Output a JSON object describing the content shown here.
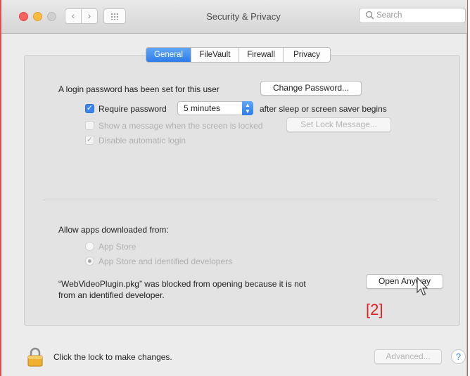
{
  "window": {
    "title": "Security & Privacy",
    "search_placeholder": "Search"
  },
  "tabs": [
    {
      "label": "General",
      "active": true
    },
    {
      "label": "FileVault",
      "active": false
    },
    {
      "label": "Firewall",
      "active": false
    },
    {
      "label": "Privacy",
      "active": false
    }
  ],
  "general": {
    "login_password_text": "A login password has been set for this user",
    "change_password_label": "Change Password...",
    "require_password": {
      "checked": true,
      "label": "Require password",
      "interval": "5 minutes",
      "suffix": "after sleep or screen saver begins"
    },
    "show_message": {
      "checked": false,
      "label": "Show a message when the screen is locked",
      "button": "Set Lock Message..."
    },
    "disable_auto_login": {
      "checked": true,
      "label": "Disable automatic login"
    }
  },
  "allow_apps": {
    "heading": "Allow apps downloaded from:",
    "options": [
      {
        "label": "App Store",
        "selected": false
      },
      {
        "label": "App Store and identified developers",
        "selected": true
      }
    ],
    "blocked_line1": "“WebVideoPlugin.pkg” was blocked from opening because it is not",
    "blocked_line2": "from an identified developer.",
    "open_anyway_label": "Open Anyway"
  },
  "annotation": "[2]",
  "footer": {
    "lock_text": "Click the lock to make changes.",
    "advanced_label": "Advanced...",
    "help_label": "?"
  },
  "colors": {
    "accent": "#3d85ec",
    "annotation": "#e02020",
    "close": "#fc615d",
    "minimize": "#fdbc40"
  },
  "icons": [
    "search-icon",
    "lock-icon",
    "cursor-icon",
    "back-icon",
    "forward-icon",
    "grid-icon"
  ]
}
